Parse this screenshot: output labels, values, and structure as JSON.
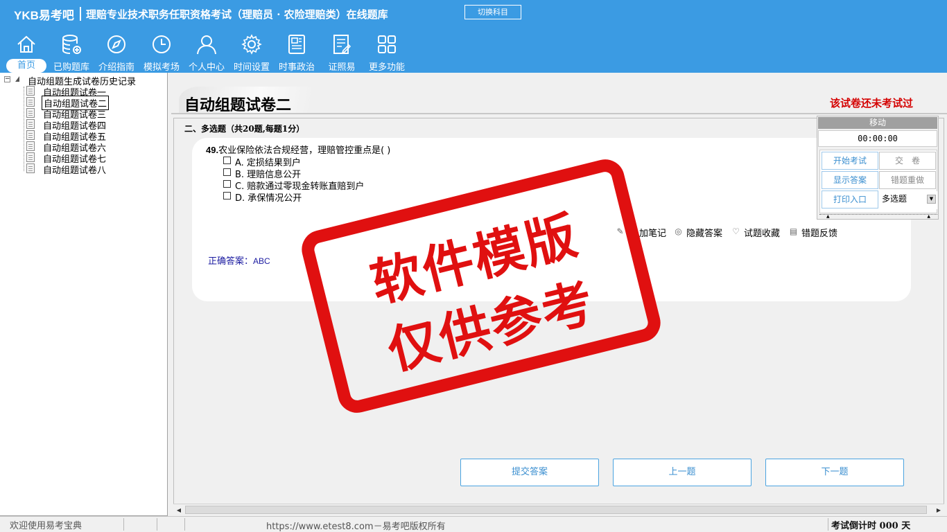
{
  "header": {
    "logo": "YKB易考吧",
    "title": "理赔专业技术职务任职资格考试（理赔员 · 农险理赔类）在线题库",
    "switch_button": "切换科目",
    "nav": [
      {
        "label": "首页",
        "icon": "home-icon"
      },
      {
        "label": "已购题库",
        "icon": "database-icon"
      },
      {
        "label": "介绍指南",
        "icon": "compass-icon"
      },
      {
        "label": "模拟考场",
        "icon": "clock-icon"
      },
      {
        "label": "个人中心",
        "icon": "user-icon"
      },
      {
        "label": "时间设置",
        "icon": "gear-icon"
      },
      {
        "label": "时事政治",
        "icon": "newspaper-icon"
      },
      {
        "label": "证照易",
        "icon": "checklist-icon"
      },
      {
        "label": "更多功能",
        "icon": "grid-icon"
      }
    ]
  },
  "tree": {
    "root": "自动组题生成试卷历史记录",
    "items": [
      "自动组题试卷一",
      "自动组题试卷二",
      "自动组题试卷三",
      "自动组题试卷四",
      "自动组题试卷五",
      "自动组题试卷六",
      "自动组题试卷七",
      "自动组题试卷八"
    ],
    "selected": "自动组题试卷二"
  },
  "paper": {
    "title": "自动组题试卷二",
    "status": "该试卷还未考试过"
  },
  "question": {
    "section": "二、多选题（共20题,每题1分）",
    "number": "49.",
    "text": "农业保险依法合规经营，理赔管控重点是( )",
    "options": [
      "A. 定损结果到户",
      "B. 理赔信息公开",
      "C. 赔款通过零现金转账直赔到户",
      "D. 承保情况公开"
    ],
    "tools": [
      "加笔记",
      "隐藏答案",
      "试题收藏",
      "错题反馈"
    ],
    "answer_label": "正确答案：",
    "answer_value": "ABC"
  },
  "buttons": {
    "submit": "提交答案",
    "prev": "上一题",
    "next": "下一题"
  },
  "timer": {
    "move_label": "移动",
    "time": "00:00:00",
    "start": "开始考试",
    "hand_in": "交　卷",
    "show_answer": "显示答案",
    "redo_wrong": "错题重做",
    "print": "打印入口",
    "mode": "多选题"
  },
  "watermark": {
    "line1": "软件模版",
    "line2": "仅供参考"
  },
  "statusbar": {
    "welcome": "欢迎使用易考宝典",
    "url": "https://www.etest8.com－易考吧版权所有",
    "countdown": "考试倒计时 000 天"
  },
  "colors": {
    "header": "#3b9be3",
    "accent_red": "#e01010",
    "status_red": "#d40000",
    "button_text": "#3b8fd0"
  }
}
